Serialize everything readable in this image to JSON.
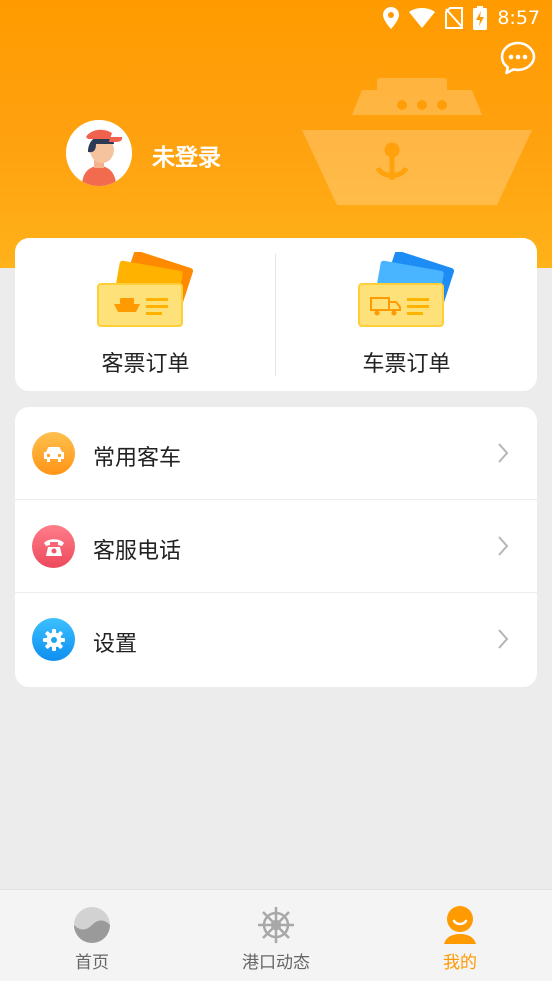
{
  "status_bar": {
    "time": "8:57"
  },
  "profile": {
    "username": "未登录"
  },
  "tickets": [
    {
      "label": "客票订单",
      "icon": "ship-ticket-icon"
    },
    {
      "label": "车票订单",
      "icon": "truck-ticket-icon"
    }
  ],
  "menu": [
    {
      "label": "常用客车",
      "icon": "car-icon",
      "color": "#ff9f1c"
    },
    {
      "label": "客服电话",
      "icon": "phone-icon",
      "color": "#f05a6a"
    },
    {
      "label": "设置",
      "icon": "gear-icon",
      "color": "#1aa6f5"
    }
  ],
  "tabs": [
    {
      "label": "首页",
      "icon": "home-wave-icon",
      "active": false
    },
    {
      "label": "港口动态",
      "icon": "ship-wheel-icon",
      "active": false
    },
    {
      "label": "我的",
      "icon": "person-icon",
      "active": true
    }
  ],
  "colors": {
    "accent": "#ff9a00",
    "background": "#ececec"
  }
}
